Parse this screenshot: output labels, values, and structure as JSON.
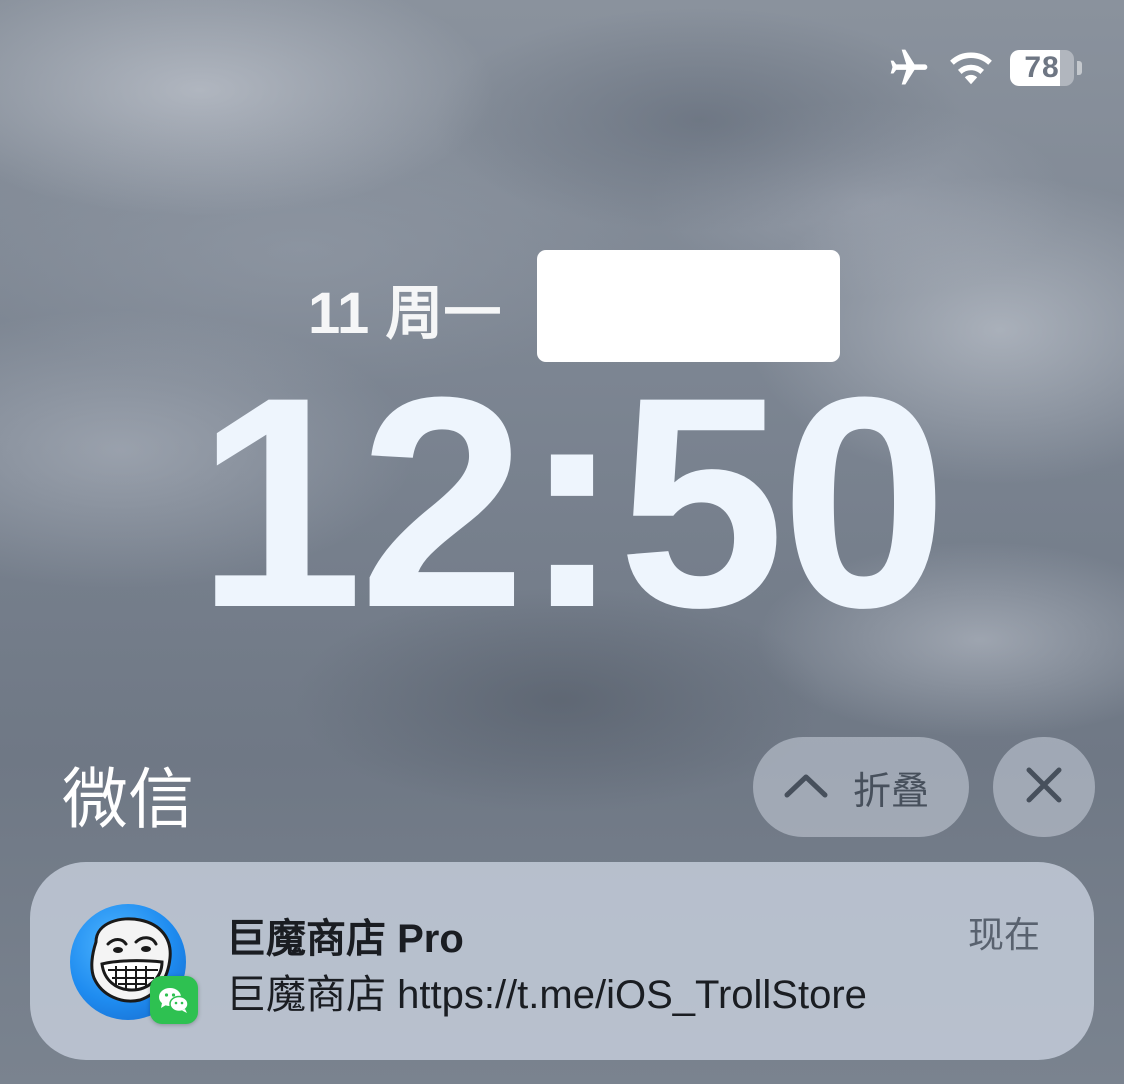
{
  "status_bar": {
    "airplane_icon": "airplane-icon",
    "wifi_icon": "wifi-icon",
    "battery_percent": "78",
    "battery_level": 0.78
  },
  "lock_screen": {
    "date": "11 周一",
    "time": "12:50"
  },
  "notification_group": {
    "app_name": "微信",
    "collapse_label": "折叠",
    "collapse_icon": "chevron-up-icon",
    "close_icon": "close-icon"
  },
  "notification": {
    "app_icon": "troll-face-app-icon",
    "badge_icon": "wechat-icon",
    "title": "巨魔商店 Pro",
    "body": "巨魔商店 https://t.me/iOS_TrollStore",
    "time": "现在"
  },
  "colors": {
    "wechat_green": "#2ec151",
    "app_icon_blue": "#1f8cf0",
    "clock_color": "#eef5fd"
  }
}
